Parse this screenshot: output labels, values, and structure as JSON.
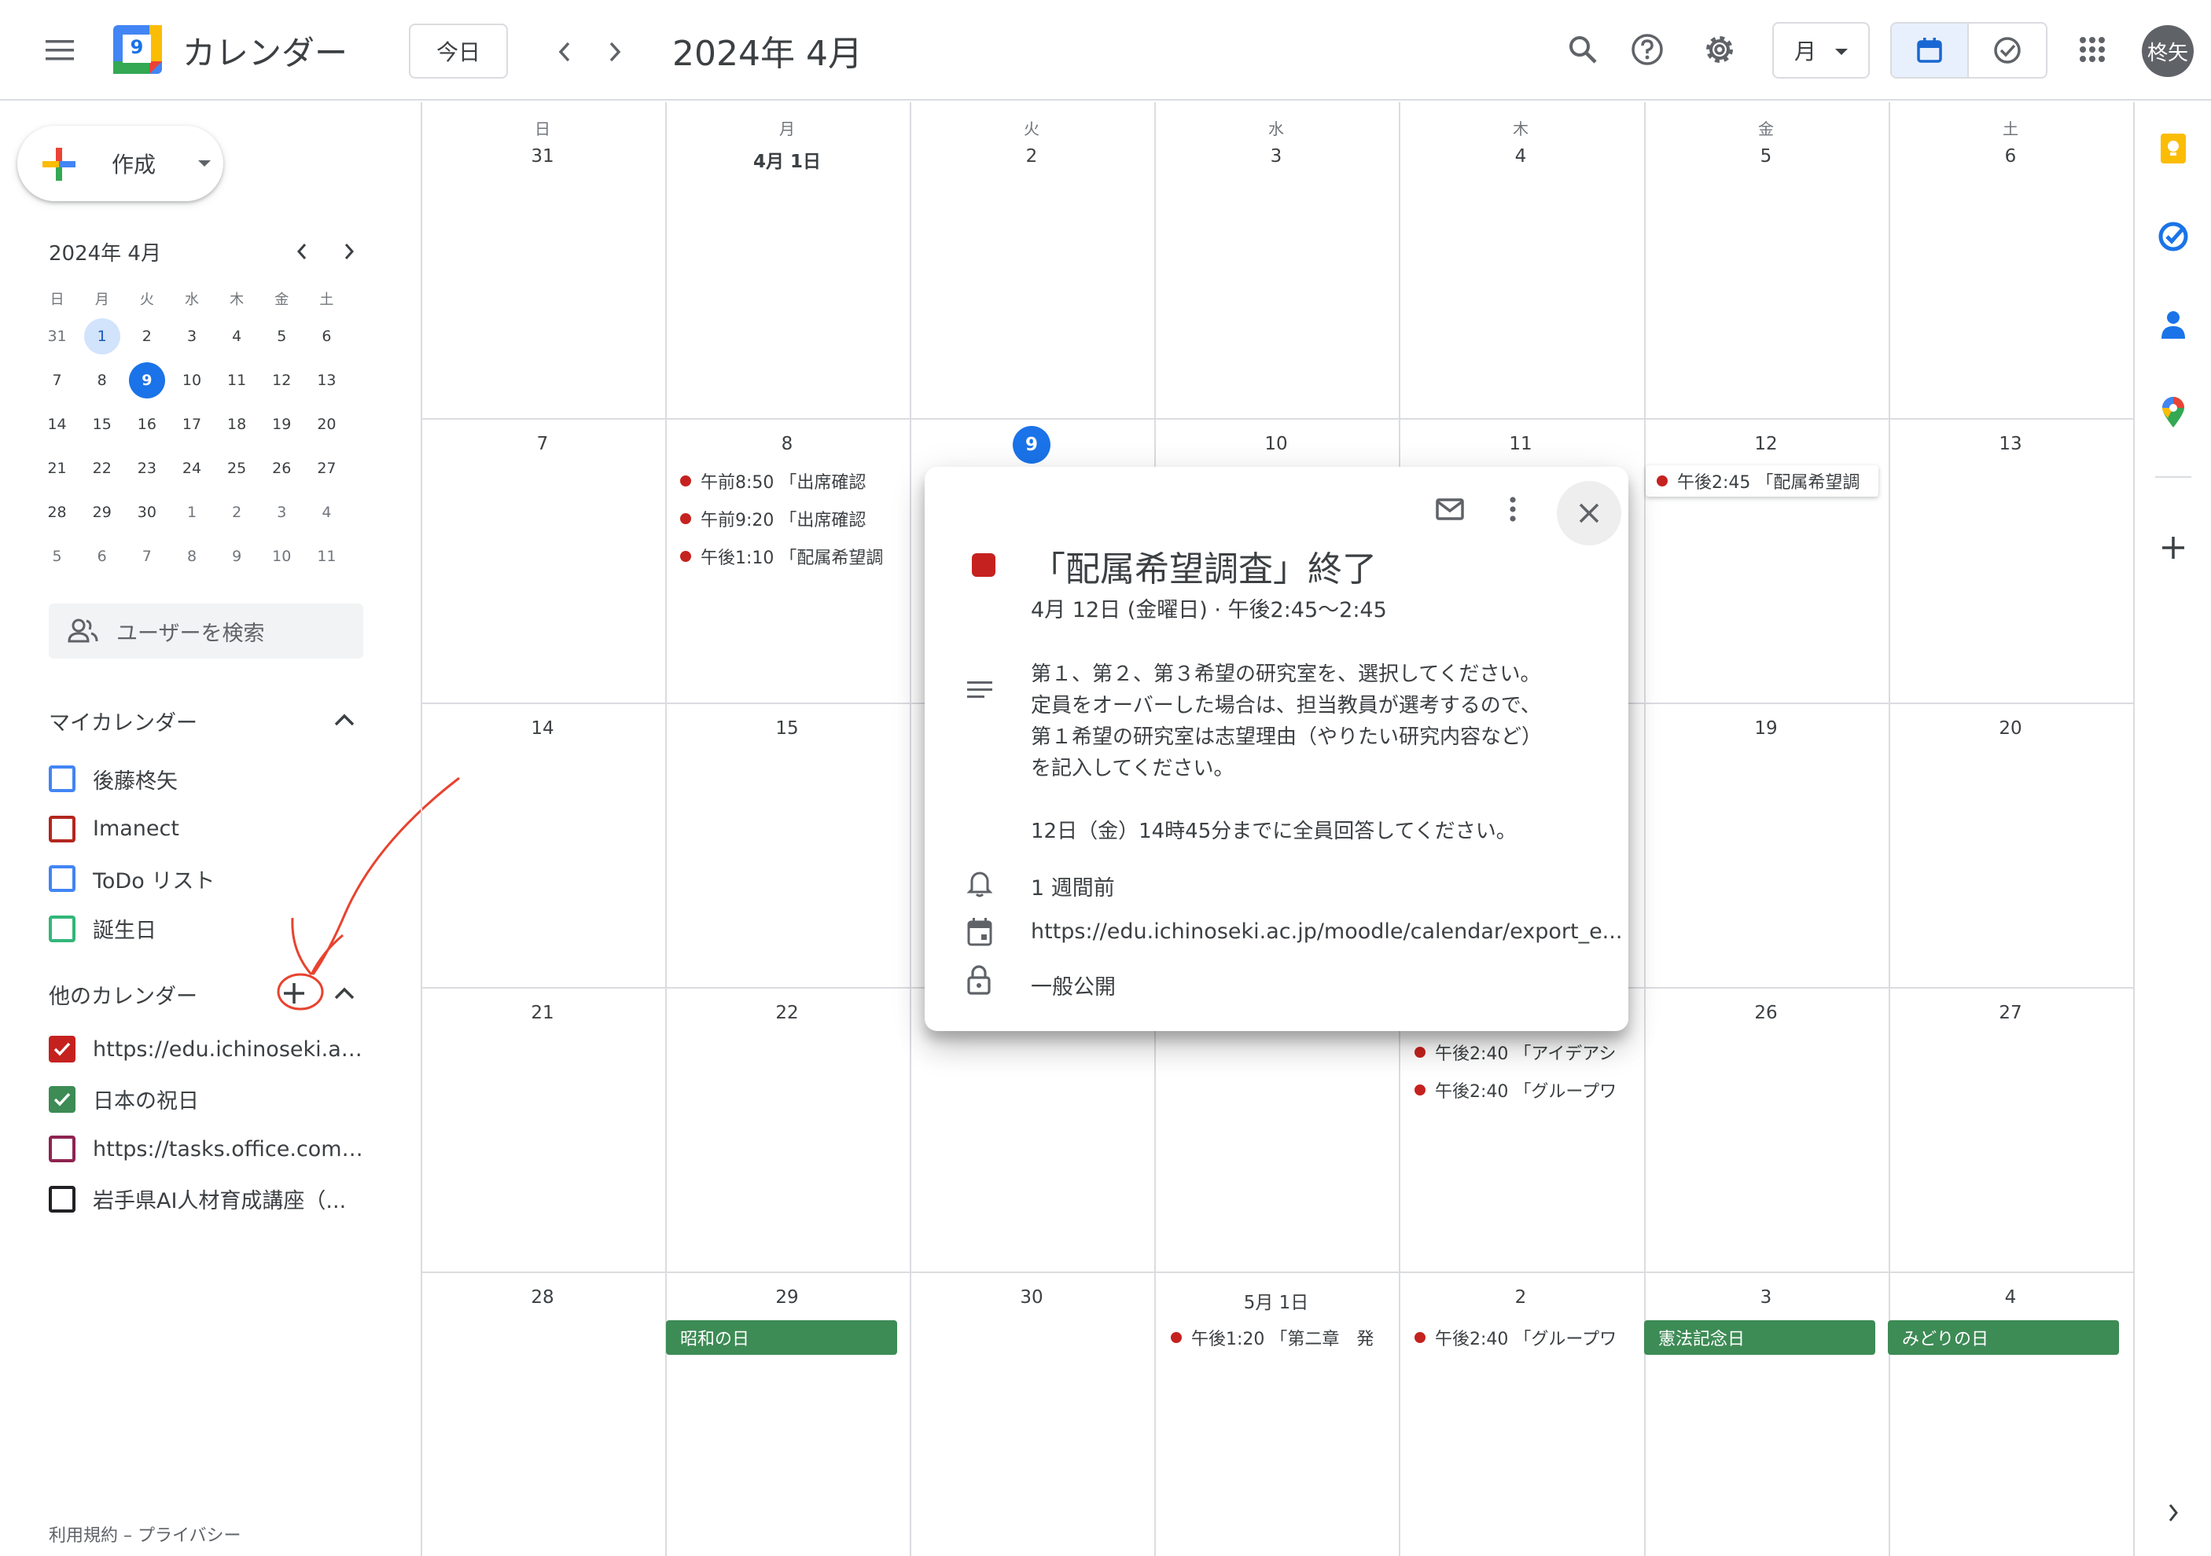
{
  "header": {
    "app_title": "カレンダー",
    "logo_day": "9",
    "today_button": "今日",
    "month_title": "2024年 4月",
    "view_select": "月",
    "avatar_initials": "柊矢"
  },
  "sidebar": {
    "create_label": "作成",
    "mini_calendar": {
      "title": "2024年 4月",
      "weekdays": [
        "日",
        "月",
        "火",
        "水",
        "木",
        "金",
        "土"
      ],
      "weeks": [
        [
          "31",
          "1",
          "2",
          "3",
          "4",
          "5",
          "6"
        ],
        [
          "7",
          "8",
          "9",
          "10",
          "11",
          "12",
          "13"
        ],
        [
          "14",
          "15",
          "16",
          "17",
          "18",
          "19",
          "20"
        ],
        [
          "21",
          "22",
          "23",
          "24",
          "25",
          "26",
          "27"
        ],
        [
          "28",
          "29",
          "30",
          "1",
          "2",
          "3",
          "4"
        ],
        [
          "5",
          "6",
          "7",
          "8",
          "9",
          "10",
          "11"
        ]
      ],
      "selected": "1",
      "today": "9"
    },
    "search_people_placeholder": "ユーザーを検索",
    "my_calendars_title": "マイカレンダー",
    "my_calendars": [
      {
        "label": "後藤柊矢",
        "color": "#4285f4",
        "checked": false
      },
      {
        "label": "Imanect",
        "color": "#b3261e",
        "checked": false
      },
      {
        "label": "ToDo リスト",
        "color": "#4285f4",
        "checked": false
      },
      {
        "label": "誕生日",
        "color": "#33b679",
        "checked": false
      }
    ],
    "other_calendars_title": "他のカレンダー",
    "other_calendars": [
      {
        "label": "https://edu.ichinoseki.ac.j...",
        "color": "#c5221f",
        "checked": true
      },
      {
        "label": "日本の祝日",
        "color": "#3d8b55",
        "checked": true
      },
      {
        "label": "https://tasks.office.com/7...",
        "color": "#8e2451",
        "checked": false
      },
      {
        "label": "岩手県AI人材育成講座（...",
        "color": "#202124",
        "checked": false
      }
    ],
    "footer": "利用規約 – プライバシー"
  },
  "grid": {
    "weekdays": [
      "日",
      "月",
      "火",
      "水",
      "木",
      "金",
      "土"
    ],
    "weeks": [
      [
        "31",
        "4月 1日",
        "2",
        "3",
        "4",
        "5",
        "6"
      ],
      [
        "7",
        "8",
        "9",
        "10",
        "11",
        "12",
        "13"
      ],
      [
        "14",
        "15",
        "16",
        "17",
        "18",
        "19",
        "20"
      ],
      [
        "21",
        "22",
        "23",
        "24",
        "25",
        "26",
        "27"
      ],
      [
        "28",
        "29",
        "30",
        "5月 1日",
        "2",
        "3",
        "4"
      ]
    ],
    "events": {
      "w1_mon_1": "午前8:50 「出席確認",
      "w1_mon_2": "午前9:20 「出席確認",
      "w1_mon_3": "午後1:10 「配属希望調",
      "w1_fri_1": "午後2:45 「配属希望調",
      "w3_thu_1": "午後2:40 「アイデアシ",
      "w3_thu_2": "午後2:40 「グループワ",
      "w4_wed_1": "午後1:20 「第二章　発",
      "w4_thu_1": "午後2:40 「グループワ"
    },
    "holidays": {
      "w4_mon": "昭和の日",
      "w4_fri": "憲法記念日",
      "w4_sat": "みどりの日"
    }
  },
  "popup": {
    "title": "「配属希望調査」終了",
    "datetime": "4月 12日 (金曜日)  ·  午後2:45～2:45",
    "description_lines": [
      "第１、第２、第３希望の研究室を、選択してください。",
      "定員をオーバーした場合は、担当教員が選考するので、",
      "第１希望の研究室は志望理由（やりたい研究内容など）",
      "を記入してください。",
      "12日（金）14時45分までに全員回答してください。"
    ],
    "reminder": "1 週間前",
    "url": "https://edu.ichinoseki.ac.jp/moodle/calendar/export_e...",
    "visibility": "一般公開",
    "color": "#c5221f"
  },
  "icons": [
    "menu-icon",
    "search-icon",
    "help-icon",
    "settings-icon",
    "calendar-view-icon",
    "tasks-view-icon",
    "apps-icon",
    "keep-icon",
    "tasks-icon",
    "contacts-icon",
    "maps-icon",
    "add-icon",
    "mail-icon",
    "more-icon",
    "close-icon",
    "description-icon",
    "bell-icon",
    "calendar-icon",
    "lock-icon"
  ]
}
